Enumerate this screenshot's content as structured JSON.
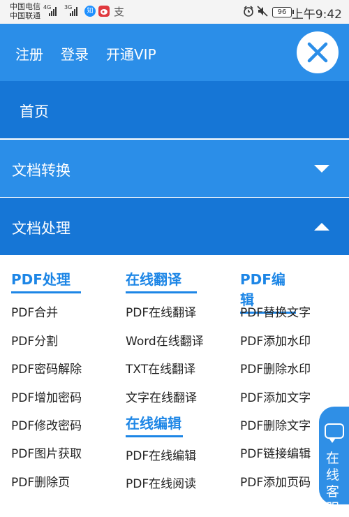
{
  "status": {
    "carrier1": "中国电信",
    "carrier2": "中国联通",
    "net1": "4G",
    "net2": "3G",
    "app1": "知",
    "app2": "支",
    "battery": "96",
    "time": "上午9:42"
  },
  "header": {
    "register": "注册",
    "login": "登录",
    "vip": "开通VIP"
  },
  "menu": {
    "home": "首页",
    "convert": "文档转换",
    "process": "文档处理"
  },
  "columns": [
    {
      "title": "PDF处理",
      "items": [
        "PDF合并",
        "PDF分割",
        "PDF密码解除",
        "PDF增加密码",
        "PDF修改密码",
        "PDF图片获取",
        "PDF删除页"
      ]
    },
    {
      "title": "在线翻译",
      "items": [
        "PDF在线翻译",
        "Word在线翻译",
        "TXT在线翻译",
        "文字在线翻译"
      ],
      "title2": "在线编辑",
      "items2": [
        "PDF在线编辑",
        "PDF在线阅读"
      ]
    },
    {
      "title": "PDF编辑",
      "items": [
        "PDF替换文字",
        "PDF添加水印",
        "PDF删除水印",
        "PDF添加文字",
        "PDF删除文字",
        "PDF链接编辑",
        "PDF添加页码"
      ]
    }
  ],
  "service": {
    "label": "在线客服"
  },
  "colors": {
    "header": "#2b8ee8",
    "home": "#1676d6",
    "convert": "#2b8ee8",
    "process": "#1676d6",
    "accent": "#1d86e6"
  }
}
